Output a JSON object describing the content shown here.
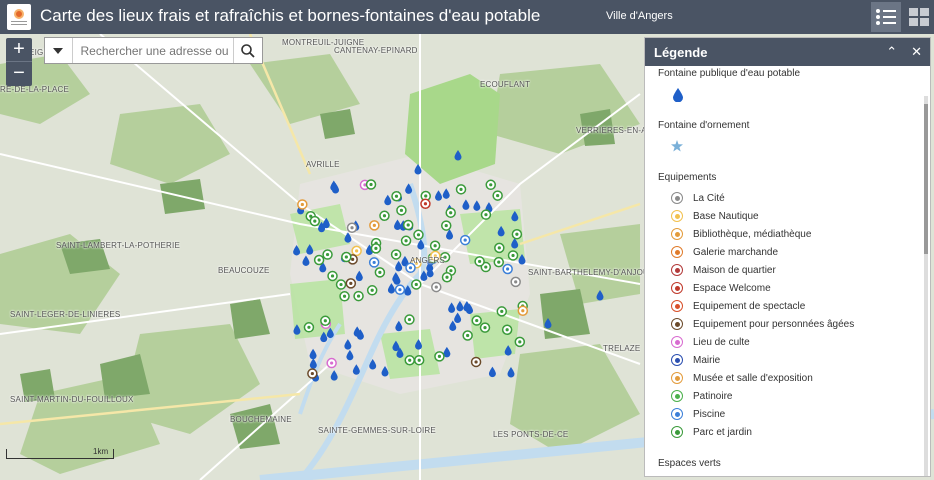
{
  "header": {
    "title": "Carte des lieux frais et rafraîchis et bornes-fontaines d'eau potable",
    "subtitle": "Ville d'Angers"
  },
  "search": {
    "placeholder": "Rechercher une adresse ou"
  },
  "zoom": {
    "in_label": "+",
    "out_label": "−"
  },
  "scale": {
    "label": "1km"
  },
  "places": [
    {
      "name": "MONTREUIL-JUIGNE"
    },
    {
      "name": "CANTENAY-EPINARD"
    },
    {
      "name": "ECOUFLANT"
    },
    {
      "name": "LA MEIGNANNE"
    },
    {
      "name": "RE-DE-LA-PLACE"
    },
    {
      "name": "VERRIERES-EN-ANJOU"
    },
    {
      "name": "AVRILLE"
    },
    {
      "name": "SAINT-LAMBERT-LA-POTHERIE"
    },
    {
      "name": "BEAUCOUZE"
    },
    {
      "name": "ANGERS"
    },
    {
      "name": "SAINT-BARTHELEMY-D'ANJOU"
    },
    {
      "name": "SAINT-LEGER-DE-LINIERES"
    },
    {
      "name": "TRELAZE"
    },
    {
      "name": "SAINT-MARTIN-DU-FOUILLOUX"
    },
    {
      "name": "BOUCHEMAINE"
    },
    {
      "name": "SAINTE-GEMMES-SUR-LOIRE"
    },
    {
      "name": "LES PONTS-DE-CE"
    }
  ],
  "legend": {
    "title": "Légende",
    "collapse_label": "⌃",
    "close_label": "✕",
    "fontaine_publique": "Fontaine publique d'eau potable",
    "fontaine_ornement": "Fontaine d'ornement",
    "equipements_title": "Equipements",
    "equipements": [
      {
        "label": "La Cité",
        "color": "#8a8a8a"
      },
      {
        "label": "Base Nautique",
        "color": "#f2c14e"
      },
      {
        "label": "Bibliothèque, médiathèque",
        "color": "#e39b3b"
      },
      {
        "label": "Galerie marchande",
        "color": "#e07b2a"
      },
      {
        "label": "Maison de quartier",
        "color": "#b23a3a"
      },
      {
        "label": "Espace Welcome",
        "color": "#c0392b"
      },
      {
        "label": "Equipement de spectacle",
        "color": "#d8502a"
      },
      {
        "label": "Equipement pour personnées âgées",
        "color": "#6b4a2a"
      },
      {
        "label": "Lieu de culte",
        "color": "#d86bd0"
      },
      {
        "label": "Mairie",
        "color": "#2b4fb0"
      },
      {
        "label": "Musée et salle d'exposition",
        "color": "#e39b3b"
      },
      {
        "label": "Patinoire",
        "color": "#4bb04b"
      },
      {
        "label": "Piscine",
        "color": "#3b7fd8"
      },
      {
        "label": "Parc et jardin",
        "color": "#3a9a3a"
      }
    ],
    "espaces_verts": "Espaces verts"
  },
  "colors": {
    "header": "#4a5464",
    "fountain": "#1f5fc8",
    "park": "#3a9a3a",
    "green_area": "#a8d88a",
    "water": "#c2dcef"
  }
}
